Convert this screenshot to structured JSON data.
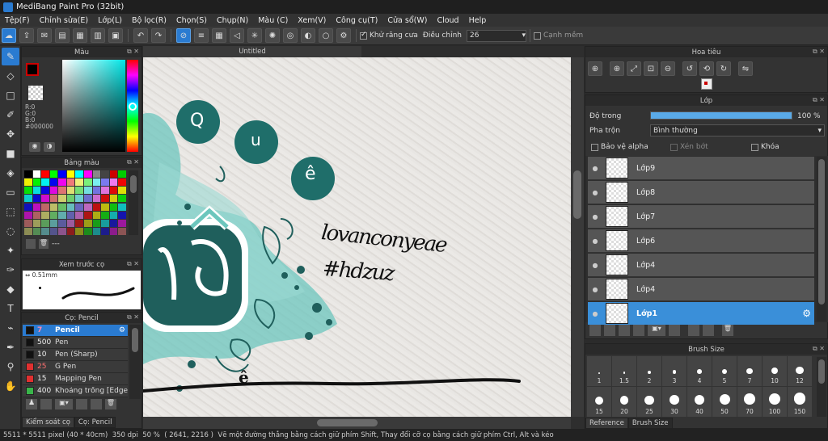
{
  "window": {
    "title": "MediBang Paint Pro (32bit)"
  },
  "menu": [
    "Tệp(F)",
    "Chỉnh sửa(E)",
    "Lớp(L)",
    "Bộ lọc(R)",
    "Chọn(S)",
    "Chụp(N)",
    "Màu (C)",
    "Xem(V)",
    "Công cụ(T)",
    "Cửa sổ(W)",
    "Cloud",
    "Help"
  ],
  "toolbar": {
    "antialias_label": "Khử răng cưa",
    "correction_label": "Điều chỉnh",
    "correction_value": "26",
    "edge_label": "Cạnh mềm"
  },
  "color_panel": {
    "title": "Màu",
    "r": "R:0",
    "g": "G:0",
    "b": "B:0",
    "hex": "#000000"
  },
  "palette_panel": {
    "title": "Bảng màu",
    "footer_text": "---"
  },
  "preview_panel": {
    "title": "Xem trước cọ",
    "size": "0.51mm"
  },
  "brush_panel": {
    "title": "Cọ: Pencil",
    "brushes": [
      {
        "size": "7",
        "name": "Pencil",
        "color": "#111111"
      },
      {
        "size": "500",
        "name": "Pen",
        "color": "#111111"
      },
      {
        "size": "10",
        "name": "Pen (Sharp)",
        "color": "#111111"
      },
      {
        "size": "25",
        "name": "G Pen",
        "color": "#e03030"
      },
      {
        "size": "15",
        "name": "Mapping Pen",
        "color": "#e03030"
      },
      {
        "size": "400",
        "name": "Khoảng trống [Edge",
        "color": "#39b54a"
      }
    ]
  },
  "canvas": {
    "tab": "Untitled",
    "handwriting_line1": "lovanconyeae",
    "handwriting_line2": "#hdzuz",
    "letters": [
      "Q",
      "u",
      "ê"
    ],
    "lower_letter": "ê"
  },
  "navigator": {
    "title": "Hoa tiêu"
  },
  "layer_panel": {
    "title": "Lớp",
    "opacity_label": "Độ trong",
    "opacity_value": "100 %",
    "opacity": 1.0,
    "blend_label": "Pha trộn",
    "blend_value": "Bình thường",
    "protect_alpha": "Bảo vệ alpha",
    "clipping": "Xén bớt",
    "lock": "Khóa",
    "layers": [
      "Lớp9",
      "Lớp8",
      "Lớp7",
      "Lớp6",
      "Lớp4",
      "Lớp4",
      "Lớp1"
    ]
  },
  "brush_size_panel": {
    "title": "Brush Size",
    "row1": [
      "1",
      "1.5",
      "2",
      "3",
      "4",
      "5",
      "7",
      "10",
      "12"
    ],
    "row2": [
      "15",
      "20",
      "25",
      "30",
      "40",
      "50",
      "70",
      "100",
      "150"
    ],
    "tabs": [
      "Reference",
      "Brush Size"
    ]
  },
  "bottom_tabs": [
    "Kiểm soát cọ",
    "Cọ: Pencil"
  ],
  "status": {
    "size": "5511 * 5511 pixel",
    "physical": "(40 * 40cm)",
    "dpi": "350 dpi",
    "zoom": "50 %",
    "coords": "( 2641, 2216 )",
    "hint": "Vẽ một đường thẳng bằng cách giữ phím Shift, Thay đổi cỡ cọ bằng cách giữ phím Ctrl, Alt và kéo"
  },
  "colors": {
    "accent": "#2a7bd1",
    "teal": "#1f6e6a"
  }
}
